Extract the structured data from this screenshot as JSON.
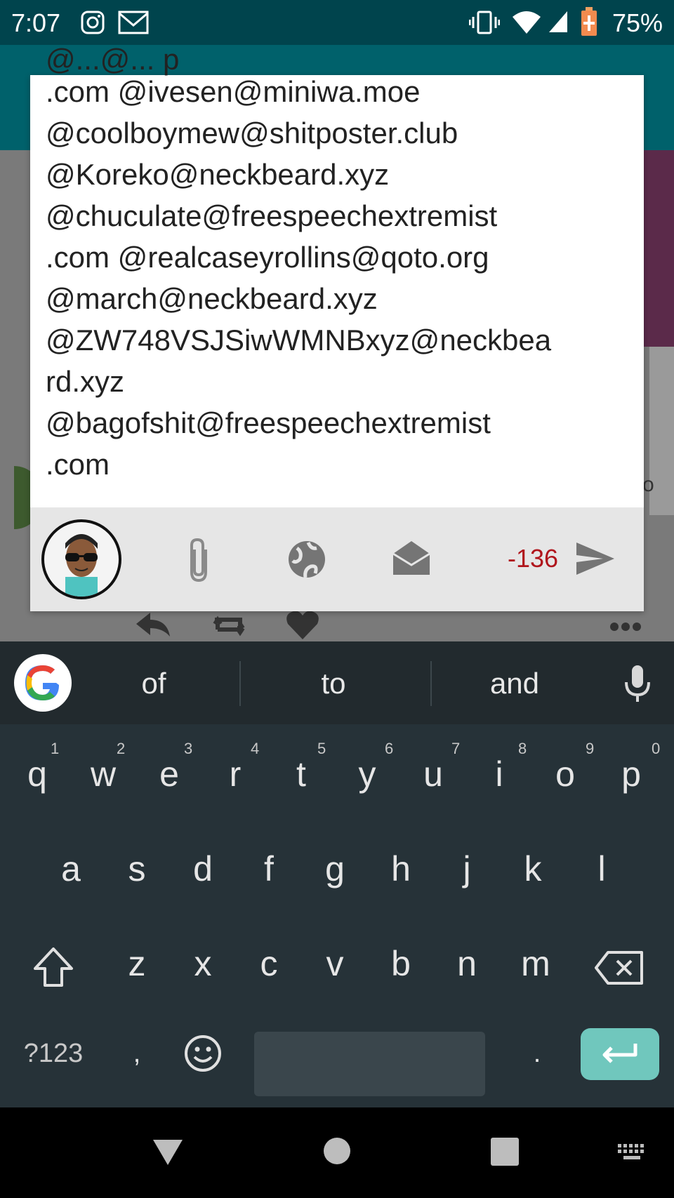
{
  "status_bar": {
    "time": "7:07",
    "battery_percent": "75%",
    "icons": [
      "instagram-icon",
      "gmail-icon",
      "vibrate-icon",
      "wifi-icon",
      "signal-icon",
      "battery-charging-icon"
    ]
  },
  "compose": {
    "text_cut_top": "@...@... p",
    "text": ".com @ivesen@miniwa.moe @coolboymew@shitposter.club @Koreko@neckbeard.xyz @chuculate@freespeechextremist .com @realcaseyrollins@qoto.org @march@neckbeard.xyz @ZW748VSJSiwWMNBxyz@neckbea rd.xyz @bagofshit@freespeechextremist .com",
    "lines": [
      ".com @ivesen@miniwa.moe",
      "@coolboymew@shitposter.club",
      "@Koreko@neckbeard.xyz",
      "@chuculate@freespeechextremist",
      ".com @realcaseyrollins@qoto.org",
      "@march@neckbeard.xyz",
      "@ZW748VSJSiwWMNBxyz@neckbea",
      "rd.xyz",
      "@bagofshit@freespeechextremist",
      ".com"
    ],
    "char_counter": "-136",
    "toolbar_icons": [
      "attach-icon",
      "globe-visibility-icon",
      "envelope-open-icon",
      "send-icon"
    ],
    "counter_color": "#b0151c"
  },
  "keyboard": {
    "suggestions": [
      "of",
      "to",
      "and"
    ],
    "row1": [
      "q",
      "w",
      "e",
      "r",
      "t",
      "y",
      "u",
      "i",
      "o",
      "p"
    ],
    "row1_hints": [
      "1",
      "2",
      "3",
      "4",
      "5",
      "6",
      "7",
      "8",
      "9",
      "0"
    ],
    "row2": [
      "a",
      "s",
      "d",
      "f",
      "g",
      "h",
      "j",
      "k",
      "l"
    ],
    "row3": [
      "z",
      "x",
      "c",
      "v",
      "b",
      "n",
      "m"
    ],
    "symbols_key": "?123",
    "comma": ",",
    "period": ".",
    "enter_color": "#70c7bd"
  }
}
